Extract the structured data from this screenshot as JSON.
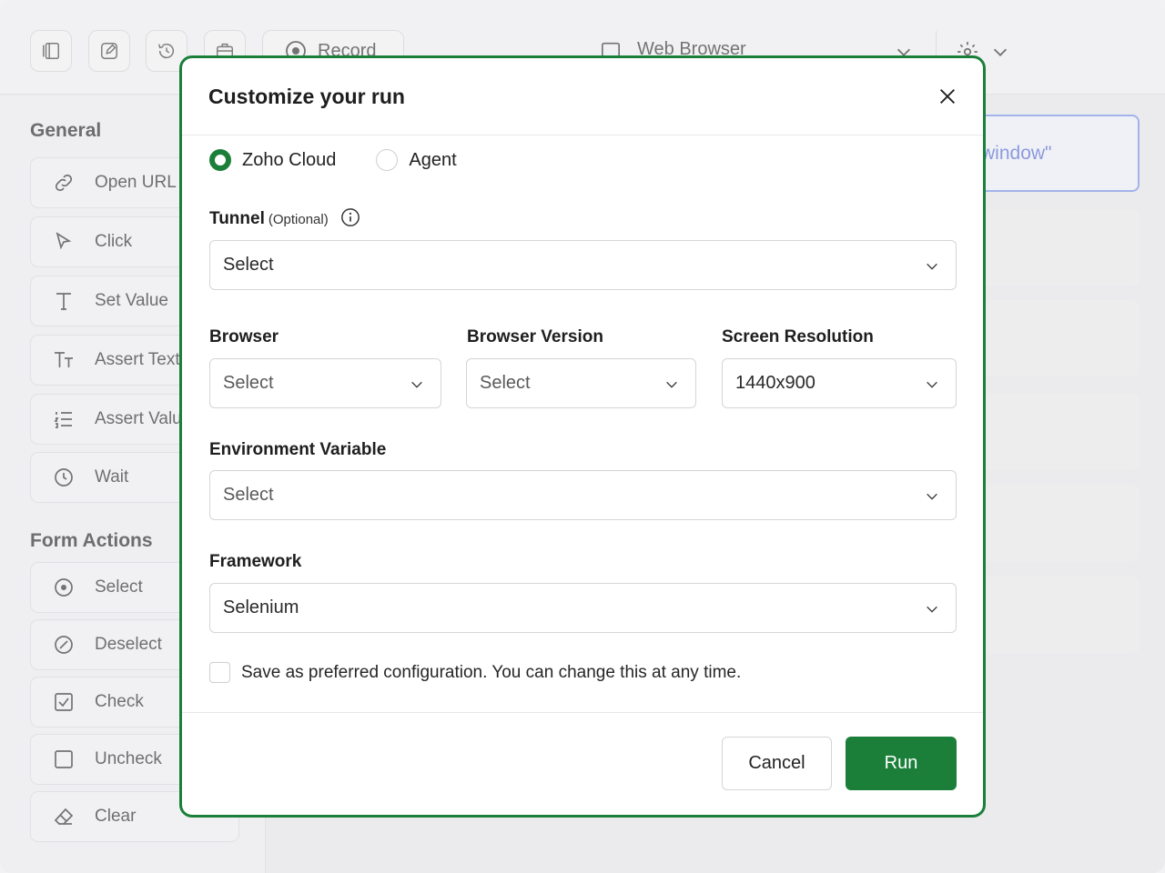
{
  "toolbar": {
    "record_label": "Record",
    "browser_label": "Web Browser"
  },
  "sidebar": {
    "general_title": "General",
    "general_items": [
      {
        "label": "Open URL",
        "icon": "link-icon"
      },
      {
        "label": "Click",
        "icon": "cursor-icon"
      },
      {
        "label": "Set Value",
        "icon": "text-t-icon"
      },
      {
        "label": "Assert Text",
        "icon": "text-size-icon"
      },
      {
        "label": "Assert Value",
        "icon": "list-numbered-icon"
      },
      {
        "label": "Wait",
        "icon": "clock-icon"
      }
    ],
    "form_title": "Form Actions",
    "form_items": [
      {
        "label": "Select",
        "icon": "radio-target-icon"
      },
      {
        "label": "Deselect",
        "icon": "slash-circle-icon"
      },
      {
        "label": "Check",
        "icon": "checkbox-checked-icon"
      },
      {
        "label": "Uncheck",
        "icon": "checkbox-empty-icon"
      },
      {
        "label": "Clear",
        "icon": "eraser-icon"
      }
    ]
  },
  "canvas": {
    "highlighted_step_text": "window\""
  },
  "modal": {
    "title": "Customize your run",
    "run_on": {
      "options": [
        "Zoho Cloud",
        "Agent"
      ],
      "selected": "Zoho Cloud"
    },
    "tunnel": {
      "label": "Tunnel",
      "optional": "(Optional)",
      "value": "Select"
    },
    "browser": {
      "label": "Browser",
      "value": "Select"
    },
    "browser_version": {
      "label": "Browser Version",
      "value": "Select"
    },
    "screen_resolution": {
      "label": "Screen Resolution",
      "value": "1440x900"
    },
    "environment_variable": {
      "label": "Environment Variable",
      "value": "Select"
    },
    "framework": {
      "label": "Framework",
      "value": "Selenium"
    },
    "save_preference": {
      "label": "Save as preferred configuration. You can change this at any time.",
      "checked": false
    },
    "cancel_label": "Cancel",
    "run_label": "Run"
  },
  "colors": {
    "accent_green": "#1b7f3a",
    "highlight_blue": "#7d95e8"
  }
}
